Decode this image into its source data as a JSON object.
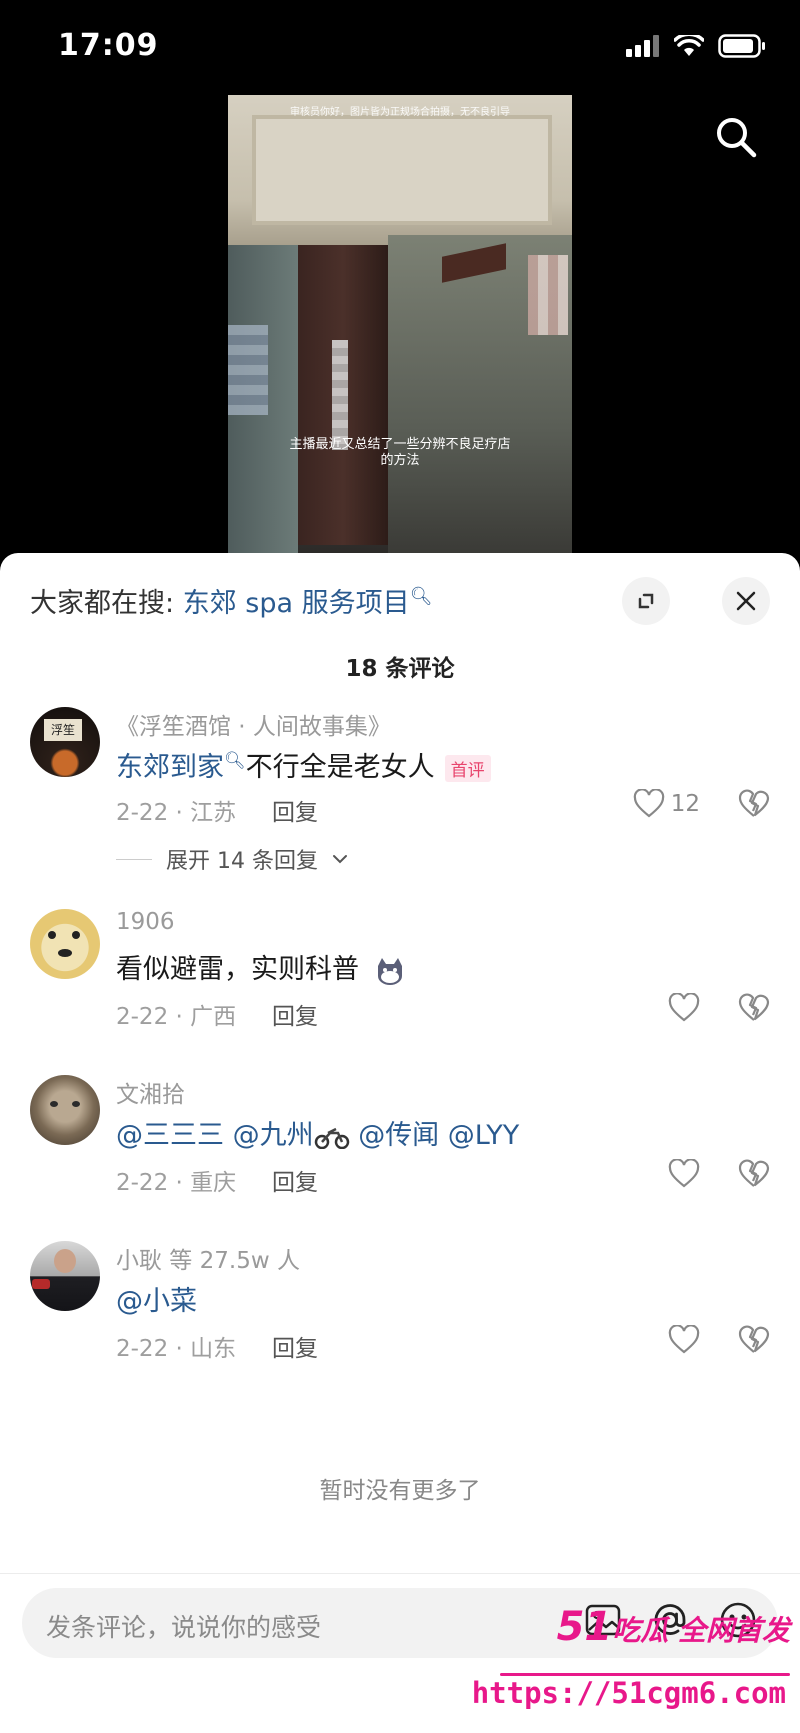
{
  "status_bar": {
    "time": "17:09"
  },
  "video": {
    "top_text": "审核员你好，图片皆为正规场合拍摄，无不良引导",
    "caption_line1": "主播最近又总结了一些分辨不良足疗店",
    "caption_line2": "的方法"
  },
  "hot_search": {
    "prefix": "大家都在搜: ",
    "query": "东郊 spa 服务项目"
  },
  "comment_count": "18 条评论",
  "comments": [
    {
      "user": "《浮笙酒馆 · 人间故事集》",
      "mention": "东郊到家",
      "text": "不行全是老女人",
      "badge": "首评",
      "meta": "2-22 · 江苏",
      "reply": "回复",
      "likes": "12",
      "expand": "展开 14 条回复"
    },
    {
      "user": "1906",
      "text": "看似避雷，实则科普",
      "meta": "2-22 · 广西",
      "reply": "回复"
    },
    {
      "user": "文湘拾",
      "mentions": [
        "@三三三",
        "@九州",
        "@传闻",
        "@LYY"
      ],
      "meta": "2-22 · 重庆",
      "reply": "回复"
    },
    {
      "user": "小耿 等 27.5w 人",
      "mention": "@小菜",
      "meta": "2-22 · 山东",
      "reply": "回复"
    }
  ],
  "no_more": "暂时没有更多了",
  "input": {
    "placeholder": "发条评论，说说你的感受"
  },
  "watermark": {
    "line1_num": "51",
    "line1_text": "吃瓜 全网首发",
    "line2": "https://51cgm6.com"
  },
  "colors": {
    "link": "#2a5a8f",
    "badge": "#e8456d",
    "watermark": "#e8188a"
  }
}
